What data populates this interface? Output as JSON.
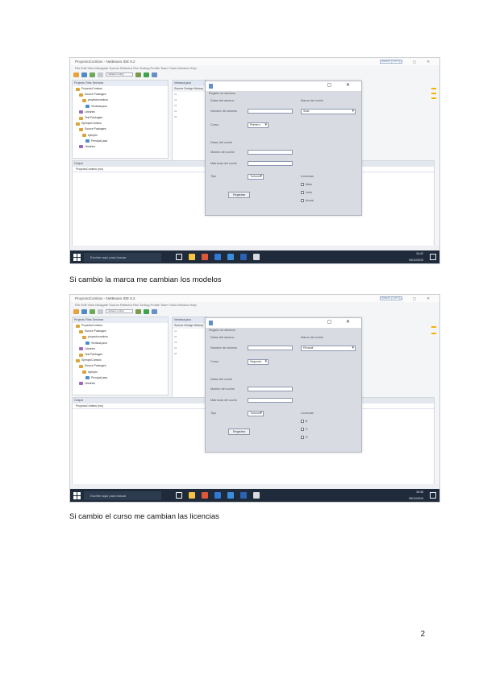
{
  "screenshots": [
    {
      "ide": {
        "title": "ProyectoCombos - NetBeans IDE 8.2",
        "quick_search": "Search (Ctrl+I)",
        "menu": "File  Edit  View  Navigate  Source  Refactor  Run  Debug  Profile  Team  Tools  Window  Help",
        "config_combo": "<default config>",
        "explorer_header": "Projects  Files  Services",
        "tree": [
          "ProyectoCombos",
          "Source Packages",
          "proyectocombos",
          "Ventana.java",
          "Libraries",
          "Test Packages",
          "EjemploCombos",
          "Source Packages",
          "ejemplo",
          "Principal.java",
          "Libraries"
        ],
        "editor_header": "Ventana.java",
        "editor_tabs": "Source  Design  History",
        "output_header": "Output",
        "output_tab": "ProyectoCombos (run)",
        "status": "",
        "taskbar_search": "Escribe aquí para buscar",
        "tray_time": "16:42",
        "tray_date": "05/11/2019"
      },
      "dialog": {
        "subtitle": "Registro de alumnos",
        "section_left": "Datos del alumno",
        "section_right": "Marca del coche",
        "name_label": "Nombre del alumno",
        "course_label": "Curso",
        "course_value": "Primero",
        "brand_value": "Seat",
        "section_left2": "Datos del coche",
        "model_label": "Modelo del coche",
        "plate_label": "Matrícula del coche",
        "type_label": "Tipo",
        "type_value": "Turismo",
        "section_right2": "Licencias",
        "radio1": "Ibiza",
        "radio2": "León",
        "radio3": "Arona",
        "button": "Registrar"
      }
    },
    {
      "ide": {
        "title": "ProyectoCombos - NetBeans IDE 8.2",
        "quick_search": "Search (Ctrl+I)",
        "menu": "File  Edit  View  Navigate  Source  Refactor  Run  Debug  Profile  Team  Tools  Window  Help",
        "config_combo": "<default config>",
        "explorer_header": "Projects  Files  Services",
        "tree": [
          "ProyectoCombos",
          "Source Packages",
          "proyectocombos",
          "Ventana.java",
          "Libraries",
          "Test Packages",
          "EjemploCombos",
          "Source Packages",
          "ejemplo",
          "Principal.java",
          "Libraries"
        ],
        "editor_header": "Ventana.java",
        "editor_tabs": "Source  Design  History",
        "output_header": "Output",
        "output_tab": "ProyectoCombos (run)",
        "status": "",
        "taskbar_search": "Escribe aquí para buscar",
        "tray_time": "16:45",
        "tray_date": "05/11/2019"
      },
      "dialog": {
        "subtitle": "Registro de alumnos",
        "section_left": "Datos del alumno",
        "section_right": "Marca del coche",
        "name_label": "Nombre del alumno",
        "course_label": "Curso",
        "course_value": "Segundo",
        "brand_value": "Renault",
        "section_left2": "Datos del coche",
        "model_label": "Modelo del coche",
        "plate_label": "Matrícula del coche",
        "type_label": "Tipo",
        "type_value": "Turismo",
        "section_right2": "Licencias",
        "radio1": "B",
        "radio2": "C",
        "radio3": "D",
        "button": "Registrar"
      }
    }
  ],
  "captions": [
    "Si cambio la marca me cambian los modelos",
    "Si cambio el curso me cambian las licencias"
  ],
  "page_number": "2",
  "colors": {
    "taskbar": "#1f2b3a",
    "dialog_bg": "#d9dbe2",
    "ide_bg": "#f4f5f7"
  }
}
